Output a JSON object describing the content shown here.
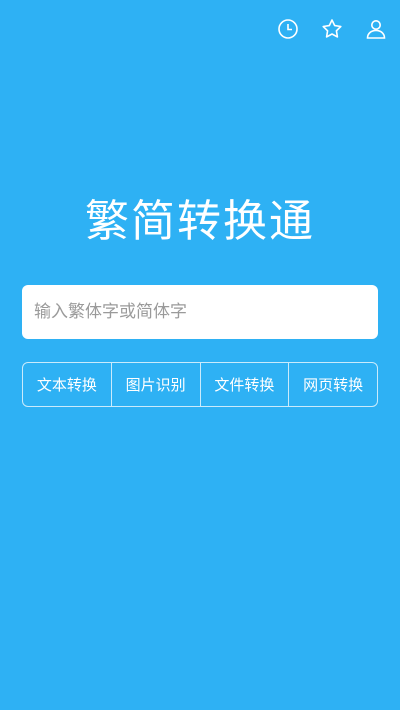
{
  "header": {
    "icons": [
      "history-icon",
      "favorite-star-icon",
      "user-profile-icon"
    ]
  },
  "main": {
    "title": "繁简转换通",
    "input": {
      "placeholder": "输入繁体字或简体字",
      "value": ""
    },
    "actions": [
      {
        "label": "文本转换"
      },
      {
        "label": "图片识别"
      },
      {
        "label": "文件转换"
      },
      {
        "label": "网页转换"
      }
    ]
  },
  "colors": {
    "background": "#2eb1f4",
    "text": "#ffffff",
    "input_bg": "#ffffff",
    "placeholder": "#9a9a9a"
  }
}
